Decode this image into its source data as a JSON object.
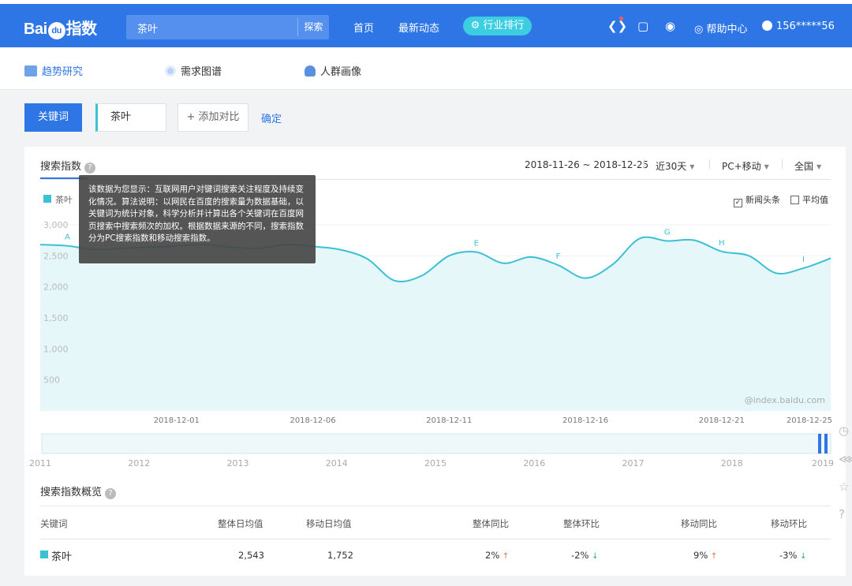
{
  "header": {
    "logo_text": "Baidu指数",
    "logo_parts": [
      "Bai",
      "du",
      "指数"
    ],
    "search_value": "茶叶",
    "search_button": "探索",
    "nav": [
      "首页",
      "最新动态"
    ],
    "rank_button": "行业排行",
    "help": "帮助中心",
    "user": "156*****56",
    "icons": [
      "baidu-logo-icon",
      "phone-icon",
      "wechat-icon",
      "help-icon",
      "user-avatar-icon"
    ]
  },
  "subnav": {
    "items": [
      {
        "label": "趋势研究",
        "icon": "trend-icon"
      },
      {
        "label": "需求图谱",
        "icon": "radar-icon"
      },
      {
        "label": "人群画像",
        "icon": "person-icon"
      }
    ]
  },
  "keywords": {
    "label": "关键词",
    "value": "茶叶",
    "add": "添加对比",
    "confirm": "确定"
  },
  "panel": {
    "title": "搜索指数",
    "date_range": "2018-11-26 ~ 2018-12-25",
    "period": "近30天",
    "device": "PC+移动",
    "region": "全国",
    "legend": "茶叶",
    "check_news": "新闻头条",
    "check_avg": "平均值",
    "watermark": "@index.baidu.com",
    "tooltip": "该数据为您显示：互联网用户对键词搜索关注程度及持续变化情况。算法说明：以网民在百度的搜索量为数据基础，以关键词为统计对象，科学分析并计算出各个关键词在百度网页搜索中搜索频次的加权。根据数据来源的不同，搜索指数分为PC搜索指数和移动搜索指数。"
  },
  "chart_data": {
    "type": "area",
    "title": "搜索指数",
    "series": [
      {
        "name": "茶叶",
        "x": [
          "2018-11-26",
          "2018-11-27",
          "2018-11-28",
          "2018-11-29",
          "2018-11-30",
          "2018-12-01",
          "2018-12-02",
          "2018-12-03",
          "2018-12-04",
          "2018-12-05",
          "2018-12-06",
          "2018-12-07",
          "2018-12-08",
          "2018-12-09",
          "2018-12-10",
          "2018-12-11",
          "2018-12-12",
          "2018-12-13",
          "2018-12-14",
          "2018-12-15",
          "2018-12-16",
          "2018-12-17",
          "2018-12-18",
          "2018-12-19",
          "2018-12-20",
          "2018-12-21",
          "2018-12-22",
          "2018-12-23",
          "2018-12-24",
          "2018-12-25"
        ],
        "values": [
          2680,
          2660,
          2600,
          2620,
          2640,
          2660,
          2680,
          2640,
          2620,
          2680,
          2650,
          2600,
          2450,
          2100,
          2180,
          2500,
          2560,
          2380,
          2480,
          2350,
          2140,
          2360,
          2780,
          2740,
          2750,
          2570,
          2500,
          2220,
          2300,
          2460
        ]
      }
    ],
    "annotations": [
      "A",
      "E",
      "F",
      "G",
      "H",
      "I"
    ],
    "ylim": [
      0,
      3000
    ],
    "yticks": [
      "3,000",
      "2,500",
      "2,000",
      "1,500",
      "1,000",
      "500"
    ],
    "xticks": [
      "2018-12-01",
      "2018-12-06",
      "2018-12-11",
      "2018-12-16",
      "2018-12-21",
      "2018-12-25"
    ],
    "timeline_ticks": [
      "2011",
      "2012",
      "2013",
      "2014",
      "2015",
      "2016",
      "2017",
      "2018",
      "2019"
    ],
    "colors": {
      "line": "#3cc0d4",
      "fill": "#e6f7fa"
    }
  },
  "overview": {
    "title": "搜索指数概览",
    "headers": [
      "关键词",
      "整体日均值",
      "移动日均值",
      "整体同比",
      "整体环比",
      "移动同比",
      "移动环比"
    ],
    "row": {
      "keyword": "茶叶",
      "overall_avg": "2,543",
      "mobile_avg": "1,752",
      "overall_yoy": "2%",
      "overall_mom": "-2%",
      "mobile_yoy": "9%",
      "mobile_mom": "-3%"
    }
  }
}
